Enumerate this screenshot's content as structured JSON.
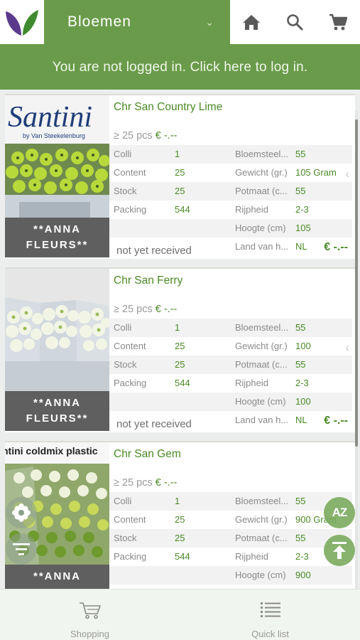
{
  "header": {
    "category": "Bloemen",
    "login_text": "You are not logged in. Click here to log in."
  },
  "products": [
    {
      "title": "Chr San Country Lime",
      "min_qty": "≥ 25 pcs",
      "price": "€ -.--",
      "brand_text": "Santini",
      "brand_sub": "by Van Steekelenburg",
      "supplier_line1": "**ANNA",
      "supplier_line2": "FLEURS**",
      "specs": [
        {
          "l1": "Colli",
          "v1": "1",
          "l2": "Bloemsteel...",
          "v2": "55"
        },
        {
          "l1": "Content",
          "v1": "25",
          "l2": "Gewicht (gr.)",
          "v2": "105 Gram"
        },
        {
          "l1": "Stock",
          "v1": "25",
          "l2": "Potmaat (c...",
          "v2": "55"
        },
        {
          "l1": "Packing",
          "v1": "544",
          "l2": "Rijpheid",
          "v2": "2-3"
        },
        {
          "l1": "",
          "v1": "",
          "l2": "Hoogte (cm)",
          "v2": "105"
        },
        {
          "l1": "",
          "v1": "",
          "l2": "Land van h...",
          "v2": "NL"
        }
      ],
      "status": "not yet received",
      "end_price": "€ -.--"
    },
    {
      "title": "Chr San Ferry",
      "min_qty": "≥ 25 pcs",
      "price": "€ -.--",
      "supplier_line1": "**ANNA",
      "supplier_line2": "FLEURS**",
      "specs": [
        {
          "l1": "Colli",
          "v1": "1",
          "l2": "Bloemsteel...",
          "v2": "55"
        },
        {
          "l1": "Content",
          "v1": "25",
          "l2": "Gewicht (gr.)",
          "v2": "100"
        },
        {
          "l1": "Stock",
          "v1": "25",
          "l2": "Potmaat (c...",
          "v2": "55"
        },
        {
          "l1": "Packing",
          "v1": "544",
          "l2": "Rijpheid",
          "v2": "2-3"
        },
        {
          "l1": "",
          "v1": "",
          "l2": "Hoogte (cm)",
          "v2": "100"
        },
        {
          "l1": "",
          "v1": "",
          "l2": "Land van h...",
          "v2": "NL"
        }
      ],
      "status": "not yet received",
      "end_price": "€ -.--"
    },
    {
      "title": "Chr San Gem",
      "min_qty": "≥ 25 pcs",
      "price": "€ -.--",
      "image_caption": "ntini coldmix plastic",
      "supplier_line1": "**ANNA",
      "specs": [
        {
          "l1": "Colli",
          "v1": "1",
          "l2": "Bloemsteel...",
          "v2": "55"
        },
        {
          "l1": "Content",
          "v1": "25",
          "l2": "Gewicht (gr.)",
          "v2": "900 Gram"
        },
        {
          "l1": "Stock",
          "v1": "25",
          "l2": "Potmaat (c...",
          "v2": "55"
        },
        {
          "l1": "Packing",
          "v1": "544",
          "l2": "Rijpheid",
          "v2": "2-3"
        },
        {
          "l1": "",
          "v1": "",
          "l2": "Hoogte (cm)",
          "v2": "900"
        }
      ]
    }
  ],
  "fabs": {
    "sort_label": "AZ"
  },
  "bottom_nav": {
    "shopping": "Shopping",
    "quicklist": "Quick list"
  },
  "colors": {
    "brand_green": "#6a9b4a",
    "text_green": "#4a8a25",
    "supplier_grey": "#5f5f5f"
  }
}
